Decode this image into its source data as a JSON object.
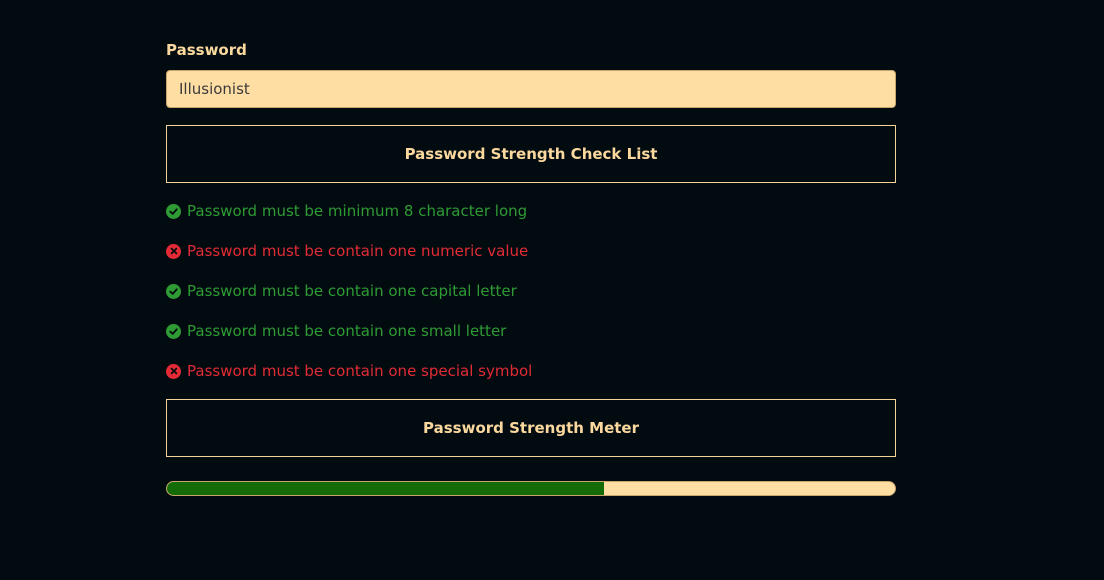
{
  "form": {
    "password_label": "Password",
    "password_value": "Illusionist"
  },
  "checklist": {
    "title": "Password Strength Check List",
    "items": [
      {
        "label": "Password must be minimum 8 character long",
        "status": "pass",
        "icon": "check-circle-icon"
      },
      {
        "label": "Password must be contain one numeric value",
        "status": "fail",
        "icon": "x-circle-icon"
      },
      {
        "label": "Password must be contain one capital letter",
        "status": "pass",
        "icon": "check-circle-icon"
      },
      {
        "label": "Password must be contain one small letter",
        "status": "pass",
        "icon": "check-circle-icon"
      },
      {
        "label": "Password must be contain one special symbol",
        "status": "fail",
        "icon": "x-circle-icon"
      }
    ]
  },
  "meter": {
    "title": "Password Strength Meter",
    "strength_fraction": 0.6
  },
  "colors": {
    "background": "#020b10",
    "accent": "#fbd89e",
    "pass": "#2e9b35",
    "fail": "#e22b36",
    "meter_fill": "#146c09"
  }
}
